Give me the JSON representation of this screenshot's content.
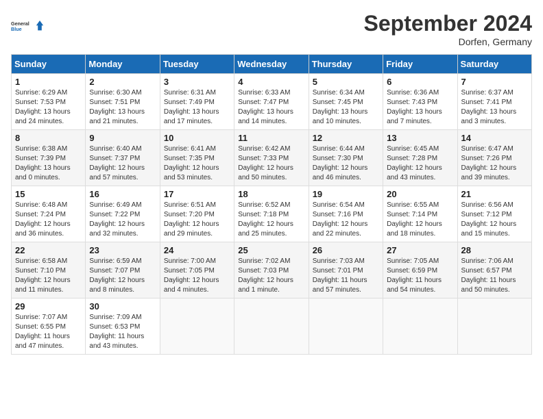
{
  "header": {
    "logo_line1": "General",
    "logo_line2": "Blue",
    "month_title": "September 2024",
    "location": "Dorfen, Germany"
  },
  "days_of_week": [
    "Sunday",
    "Monday",
    "Tuesday",
    "Wednesday",
    "Thursday",
    "Friday",
    "Saturday"
  ],
  "weeks": [
    [
      {
        "day": "1",
        "sunrise": "6:29 AM",
        "sunset": "7:53 PM",
        "daylight": "13 hours and 24 minutes."
      },
      {
        "day": "2",
        "sunrise": "6:30 AM",
        "sunset": "7:51 PM",
        "daylight": "13 hours and 21 minutes."
      },
      {
        "day": "3",
        "sunrise": "6:31 AM",
        "sunset": "7:49 PM",
        "daylight": "13 hours and 17 minutes."
      },
      {
        "day": "4",
        "sunrise": "6:33 AM",
        "sunset": "7:47 PM",
        "daylight": "13 hours and 14 minutes."
      },
      {
        "day": "5",
        "sunrise": "6:34 AM",
        "sunset": "7:45 PM",
        "daylight": "13 hours and 10 minutes."
      },
      {
        "day": "6",
        "sunrise": "6:36 AM",
        "sunset": "7:43 PM",
        "daylight": "13 hours and 7 minutes."
      },
      {
        "day": "7",
        "sunrise": "6:37 AM",
        "sunset": "7:41 PM",
        "daylight": "13 hours and 3 minutes."
      }
    ],
    [
      {
        "day": "8",
        "sunrise": "6:38 AM",
        "sunset": "7:39 PM",
        "daylight": "13 hours and 0 minutes."
      },
      {
        "day": "9",
        "sunrise": "6:40 AM",
        "sunset": "7:37 PM",
        "daylight": "12 hours and 57 minutes."
      },
      {
        "day": "10",
        "sunrise": "6:41 AM",
        "sunset": "7:35 PM",
        "daylight": "12 hours and 53 minutes."
      },
      {
        "day": "11",
        "sunrise": "6:42 AM",
        "sunset": "7:33 PM",
        "daylight": "12 hours and 50 minutes."
      },
      {
        "day": "12",
        "sunrise": "6:44 AM",
        "sunset": "7:30 PM",
        "daylight": "12 hours and 46 minutes."
      },
      {
        "day": "13",
        "sunrise": "6:45 AM",
        "sunset": "7:28 PM",
        "daylight": "12 hours and 43 minutes."
      },
      {
        "day": "14",
        "sunrise": "6:47 AM",
        "sunset": "7:26 PM",
        "daylight": "12 hours and 39 minutes."
      }
    ],
    [
      {
        "day": "15",
        "sunrise": "6:48 AM",
        "sunset": "7:24 PM",
        "daylight": "12 hours and 36 minutes."
      },
      {
        "day": "16",
        "sunrise": "6:49 AM",
        "sunset": "7:22 PM",
        "daylight": "12 hours and 32 minutes."
      },
      {
        "day": "17",
        "sunrise": "6:51 AM",
        "sunset": "7:20 PM",
        "daylight": "12 hours and 29 minutes."
      },
      {
        "day": "18",
        "sunrise": "6:52 AM",
        "sunset": "7:18 PM",
        "daylight": "12 hours and 25 minutes."
      },
      {
        "day": "19",
        "sunrise": "6:54 AM",
        "sunset": "7:16 PM",
        "daylight": "12 hours and 22 minutes."
      },
      {
        "day": "20",
        "sunrise": "6:55 AM",
        "sunset": "7:14 PM",
        "daylight": "12 hours and 18 minutes."
      },
      {
        "day": "21",
        "sunrise": "6:56 AM",
        "sunset": "7:12 PM",
        "daylight": "12 hours and 15 minutes."
      }
    ],
    [
      {
        "day": "22",
        "sunrise": "6:58 AM",
        "sunset": "7:10 PM",
        "daylight": "12 hours and 11 minutes."
      },
      {
        "day": "23",
        "sunrise": "6:59 AM",
        "sunset": "7:07 PM",
        "daylight": "12 hours and 8 minutes."
      },
      {
        "day": "24",
        "sunrise": "7:00 AM",
        "sunset": "7:05 PM",
        "daylight": "12 hours and 4 minutes."
      },
      {
        "day": "25",
        "sunrise": "7:02 AM",
        "sunset": "7:03 PM",
        "daylight": "12 hours and 1 minute."
      },
      {
        "day": "26",
        "sunrise": "7:03 AM",
        "sunset": "7:01 PM",
        "daylight": "11 hours and 57 minutes."
      },
      {
        "day": "27",
        "sunrise": "7:05 AM",
        "sunset": "6:59 PM",
        "daylight": "11 hours and 54 minutes."
      },
      {
        "day": "28",
        "sunrise": "7:06 AM",
        "sunset": "6:57 PM",
        "daylight": "11 hours and 50 minutes."
      }
    ],
    [
      {
        "day": "29",
        "sunrise": "7:07 AM",
        "sunset": "6:55 PM",
        "daylight": "11 hours and 47 minutes."
      },
      {
        "day": "30",
        "sunrise": "7:09 AM",
        "sunset": "6:53 PM",
        "daylight": "11 hours and 43 minutes."
      },
      null,
      null,
      null,
      null,
      null
    ]
  ]
}
